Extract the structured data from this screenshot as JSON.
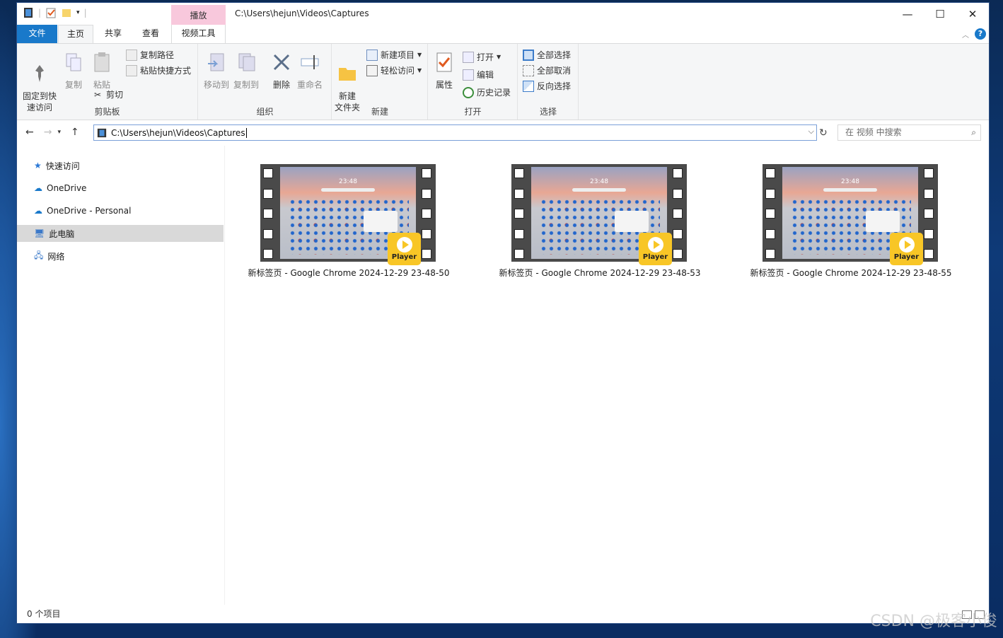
{
  "window": {
    "title": "C:\\Users\\hejun\\Videos\\Captures",
    "context_tab": "播放",
    "controls": [
      "minimize-icon",
      "maximize-icon",
      "close-icon"
    ]
  },
  "tabs": {
    "file": "文件",
    "home": "主页",
    "share": "共享",
    "view": "查看",
    "video_tools": "视频工具"
  },
  "ribbon": {
    "clipboard": {
      "label": "剪贴板",
      "pin": "固定到快\n速访问",
      "copy": "复制",
      "paste": "粘贴",
      "copy_path": "复制路径",
      "paste_shortcut": "粘贴快捷方式",
      "cut": "剪切"
    },
    "organize": {
      "label": "组织",
      "move_to": "移动到",
      "copy_to": "复制到",
      "delete": "删除",
      "rename": "重命名"
    },
    "new": {
      "label": "新建",
      "new_folder": "新建\n文件夹",
      "new_item": "新建项目",
      "easy_access": "轻松访问"
    },
    "open": {
      "label": "打开",
      "properties": "属性",
      "open": "打开",
      "edit": "编辑",
      "history": "历史记录"
    },
    "select": {
      "label": "选择",
      "select_all": "全部选择",
      "select_none": "全部取消",
      "invert": "反向选择"
    }
  },
  "address": {
    "path": "C:\\Users\\hejun\\Videos\\Captures",
    "search_placeholder": "在 视频 中搜索"
  },
  "sidebar": {
    "items": [
      {
        "label": "快速访问",
        "icon": "star-icon"
      },
      {
        "label": "OneDrive",
        "icon": "cloud-icon"
      },
      {
        "label": "OneDrive - Personal",
        "icon": "cloud-icon"
      },
      {
        "label": "此电脑",
        "icon": "computer-icon",
        "selected": true
      },
      {
        "label": "网络",
        "icon": "network-icon"
      }
    ]
  },
  "files": [
    {
      "name": "新标签页 - Google Chrome 2024-12-29 23-48-50",
      "badge": "Player",
      "thumb_time": "23:48"
    },
    {
      "name": "新标签页 - Google Chrome 2024-12-29 23-48-53",
      "badge": "Player",
      "thumb_time": "23:48"
    },
    {
      "name": "新标签页 - Google Chrome 2024-12-29 23-48-55",
      "badge": "Player",
      "thumb_time": "23:48"
    }
  ],
  "status": {
    "count": "0 个项目"
  },
  "watermark": "CSDN @极客小俊",
  "colors": {
    "accent": "#1979ca",
    "context_tab": "#f8c8dc",
    "player_badge": "#f8c626"
  }
}
